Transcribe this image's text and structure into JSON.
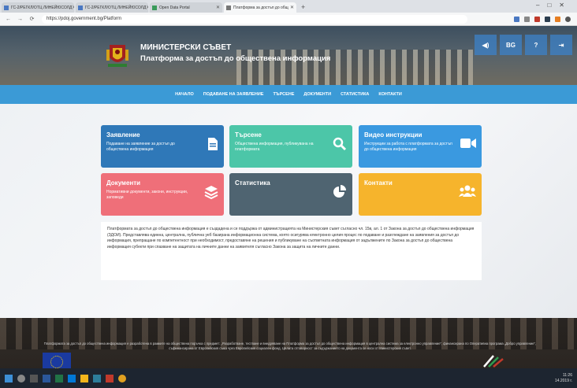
{
  "browser": {
    "tabs": [
      {
        "label": "ГС-2/РЕГКЛ/ОТЦ ЛИНЕЙЮСОЛД"
      },
      {
        "label": "ГС-2/РЕГКЛ/ОТЦ ЛИНЕЙЮСОЛД"
      },
      {
        "label": "Open Data Portal"
      },
      {
        "label": "Платформа за достъп до общ"
      }
    ],
    "url": "https://pdoj.government.bg/Platform"
  },
  "header": {
    "site_title": "МИНИСТЕРСКИ СЪВЕТ",
    "site_subtitle": "Платформа за достъп до обществена информация",
    "lang_label": "BG",
    "help_label": "?"
  },
  "menu": [
    {
      "label": "НАЧАЛО"
    },
    {
      "label": "ПОДАВАНЕ НА ЗАЯВЛЕНИЕ"
    },
    {
      "label": "ТЪРСЕНЕ"
    },
    {
      "label": "ДОКУМЕНТИ"
    },
    {
      "label": "СТАТИСТИКА"
    },
    {
      "label": "КОНТАКТИ"
    }
  ],
  "cards": [
    {
      "title": "Заявление",
      "description": "Подаване на заявление за достъп до обществена информация",
      "icon": "document-icon",
      "color": "#2f78b8"
    },
    {
      "title": "Търсене",
      "description": "Обществена информация, публикувана на платформата",
      "icon": "search-icon",
      "color": "#4cc6a8"
    },
    {
      "title": "Видео инструкции",
      "description": "Инструкции за работа с платформата за достъп до обществена информация",
      "icon": "video-camera-icon",
      "color": "#3a99e0"
    },
    {
      "title": "Документи",
      "description": "Нормативни документи, закони, инструкции, заповеди",
      "icon": "layers-icon",
      "color": "#ef6f79"
    },
    {
      "title": "Статистика",
      "description": "",
      "icon": "pie-chart-icon",
      "color": "#4f6471"
    },
    {
      "title": "Контакти",
      "description": "",
      "icon": "users-icon",
      "color": "#f6b42c"
    }
  ],
  "info_text": "Платформата за достъп до обществена информация е създадена и се поддържа от администрацията на Министерския съвет съгласно чл. 15в, ал. 1 от Закона за достъп до обществена информация (ЗДОИ). Представлява единна, централна, публична уеб базирана информационна система, която осигурява електронно целия процес по подаване и разглеждане на заявления за достъп до информация, препращане по компетентност при необходимост, предоставяне на решения и публикуване на съответната информация от задължените по Закона за достъп до обществена информация субекти при спазване на защитата на личните данни на заявителя съгласно Закона за защита на личните данни.",
  "footer": {
    "text": "Платформата за достъп до обществена информация е разработена в рамките на обществена поръчка с предмет: „Разработване, тестване и внедряване на Платформа за достъп до обществена информация в централна система за електронно управление“, финансирана по Оперативна програма „Добро управление“, съфинансирана от Европейския съюз чрез Европейския социален фонд. Цялата отговорност за съдържанието на документа се носи от Министерския съвет."
  },
  "taskbar": {
    "time": "11:26",
    "date": "14.2019 г."
  }
}
